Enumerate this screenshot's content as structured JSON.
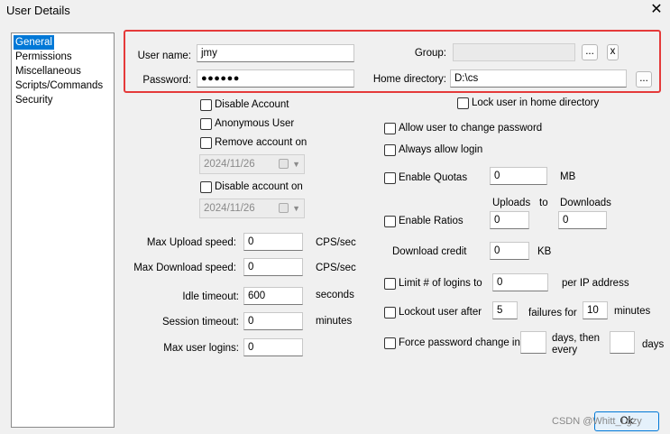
{
  "window": {
    "title": "User Details",
    "close_glyph": "✕"
  },
  "nav": {
    "items": [
      "General",
      "Permissions",
      "Miscellaneous",
      "Scripts/Commands",
      "Security"
    ],
    "selected": "General"
  },
  "general": {
    "username_label": "User name:",
    "username_value": "jmy",
    "password_label": "Password:",
    "password_value": "●●●●●●",
    "group_label": "Group:",
    "group_value": "",
    "group_browse": "...",
    "group_clear": "x",
    "homedir_label": "Home directory:",
    "homedir_value": "D:\\cs",
    "homedir_browse": "...",
    "lock_home_label": "Lock user in home directory"
  },
  "account": {
    "disable_account": "Disable Account",
    "anonymous_user": "Anonymous User",
    "remove_account_on": "Remove account on",
    "remove_date": "2024/11/26",
    "disable_account_on": "Disable account on",
    "disable_date": "2024/11/26"
  },
  "limits": {
    "max_upload_label": "Max Upload speed:",
    "max_upload_value": "0",
    "max_upload_unit": "CPS/sec",
    "max_download_label": "Max Download speed:",
    "max_download_value": "0",
    "max_download_unit": "CPS/sec",
    "idle_timeout_label": "Idle timeout:",
    "idle_timeout_value": "600",
    "idle_timeout_unit": "seconds",
    "session_timeout_label": "Session timeout:",
    "session_timeout_value": "0",
    "session_timeout_unit": "minutes",
    "max_logins_label": "Max user logins:",
    "max_logins_value": "0"
  },
  "options": {
    "allow_change_password": "Allow user to change password",
    "always_allow_login": "Always allow login",
    "enable_quotas": "Enable Quotas",
    "quota_value": "0",
    "quota_unit": "MB",
    "uploads_header": "Uploads",
    "to_header": "to",
    "downloads_header": "Downloads",
    "enable_ratios": "Enable Ratios",
    "ratio_uploads": "0",
    "ratio_downloads": "0",
    "download_credit_label": "Download credit",
    "download_credit_value": "0",
    "download_credit_unit": "KB",
    "limit_logins_label": "Limit # of logins to",
    "limit_logins_value": "0",
    "limit_logins_unit": "per IP address",
    "lockout_label": "Lockout user after",
    "lockout_value": "5",
    "lockout_failures_label": "failures for",
    "lockout_minutes_value": "10",
    "lockout_minutes_unit": "minutes",
    "force_pw_label": "Force password change in",
    "force_pw_days_value": "",
    "force_pw_then_every": "days, then every",
    "force_pw_every_value": "",
    "force_pw_days_unit": "days"
  },
  "footer": {
    "ok_label": "Ok",
    "watermark": "CSDN @Whitt_Lgzy"
  },
  "colors": {
    "accent": "#0078d7",
    "highlight": "#e53a3a"
  }
}
